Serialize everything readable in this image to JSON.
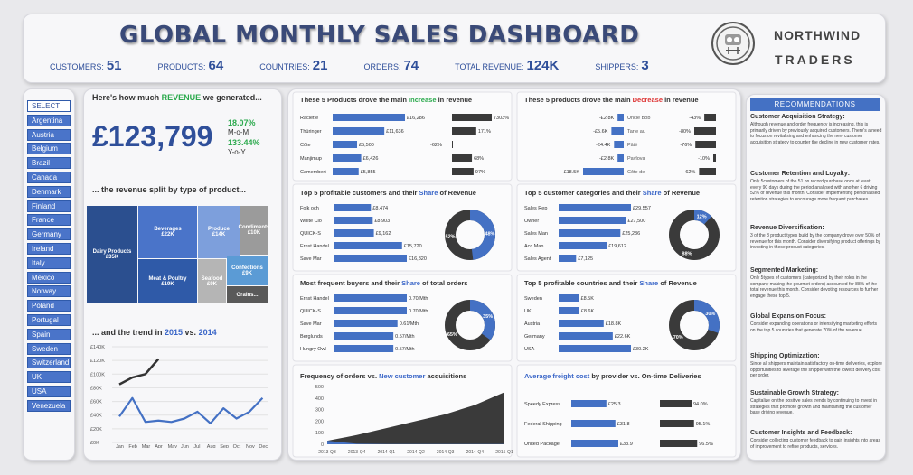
{
  "header": {
    "title": "GLOBAL MONTHLY SALES DASHBOARD",
    "brand_line1": "NORTHWIND",
    "brand_line2": "TRADERS",
    "kpis": [
      {
        "label": "CUSTOMERS:",
        "value": "51"
      },
      {
        "label": "PRODUCTS:",
        "value": "64"
      },
      {
        "label": "COUNTRIES:",
        "value": "21"
      },
      {
        "label": "ORDERS:",
        "value": "74"
      },
      {
        "label": "TOTAL REVENUE:",
        "value": "124K"
      },
      {
        "label": "SHIPPERS:",
        "value": "3"
      }
    ]
  },
  "countries": [
    "SELECT",
    "Argentina",
    "Austria",
    "Belgium",
    "Brazil",
    "Canada",
    "Denmark",
    "Finland",
    "France",
    "Germany",
    "Ireland",
    "Italy",
    "Mexico",
    "Norway",
    "Poland",
    "Portugal",
    "Spain",
    "Sweden",
    "Switzerland",
    "UK",
    "USA",
    "Venezuela"
  ],
  "revenue": {
    "title_pre": "Here's how much ",
    "title_hl": "REVENUE",
    "title_post": " we generated...",
    "value": "£123,799",
    "mom_pct": "18.07%",
    "mom_label": "M-o-M",
    "yoy_pct": "133.44%",
    "yoy_label": "Y-o-Y"
  },
  "split": {
    "title": "... the revenue split by type of product...",
    "tiles": [
      {
        "name": "Dairy Products",
        "value": "£35K"
      },
      {
        "name": "Beverages",
        "value": "£22K"
      },
      {
        "name": "Meat & Poultry",
        "value": "£19K"
      },
      {
        "name": "Produce",
        "value": "£14K"
      },
      {
        "name": "Condiments",
        "value": "£10K"
      },
      {
        "name": "Confections",
        "value": "£9K"
      },
      {
        "name": "Seafood",
        "value": "£9K"
      },
      {
        "name": "Grains...",
        "value": ""
      }
    ]
  },
  "trend": {
    "title_pre": "... and the trend in ",
    "y1": "2015",
    "title_mid": " vs. ",
    "y2": "2014",
    "yticks": [
      "£140K",
      "£120K",
      "£100K",
      "£80K",
      "£60K",
      "£40K",
      "£20K",
      "£0K"
    ],
    "months": [
      "Jan",
      "Feb",
      "Mar",
      "Apr",
      "May",
      "Jun",
      "Jul",
      "Aug",
      "Sep",
      "Oct",
      "Nov",
      "Dec"
    ]
  },
  "chart_data": [
    {
      "type": "bar",
      "title": "These 5 Products drove the main Increase in revenue",
      "categories": [
        "Raclette",
        "Thüringer",
        "Côte",
        "Manjimup",
        "Camembert"
      ],
      "values": [
        16286,
        11636,
        5500,
        6426,
        5855
      ],
      "labels": [
        "£16,286",
        "£11,636",
        "£5,500",
        "£6,426",
        "£5,855"
      ],
      "pct": [
        "7303%",
        "171%",
        "-62%",
        "68%",
        "97%"
      ]
    },
    {
      "type": "bar",
      "title": "These 5 products drove the main Decrease in revenue",
      "categories": [
        "Uncle Bob",
        "Tarte au",
        "Pâté",
        "Pavlova",
        "Côte de"
      ],
      "values": [
        -2800,
        -5600,
        -4400,
        -2800,
        -18500
      ],
      "labels": [
        "-£2.8K",
        "-£5.6K",
        "-£4.4K",
        "-£2.8K",
        "-£18.5K"
      ],
      "pct": [
        "-43%",
        "-80%",
        "-76%",
        "-10%",
        "-62%"
      ]
    },
    {
      "type": "bar",
      "title": "Top 5 profitable customers and their Share of Revenue",
      "categories": [
        "Folk och",
        "White Clo",
        "QUICK-S",
        "Ernst Handel",
        "Save Mar"
      ],
      "values": [
        8474,
        8903,
        9162,
        15720,
        16820
      ],
      "labels": [
        "£8,474",
        "£8,903",
        "£9,162",
        "£15,720",
        "£16,820"
      ],
      "donut": {
        "share": 48,
        "rest": 52
      }
    },
    {
      "type": "bar",
      "title": "Top 5 customer categories and their Share of Revenue",
      "categories": [
        "Sales Rep",
        "Owner",
        "Sales Man",
        "Acc Man",
        "Sales Agent"
      ],
      "values": [
        29557,
        27500,
        25236,
        19612,
        7125
      ],
      "labels": [
        "£29,557",
        "£27,500",
        "£25,236",
        "£19,612",
        "£7,125"
      ],
      "donut": {
        "share": 12,
        "rest": 88
      }
    },
    {
      "type": "bar",
      "title": "Most frequent buyers and their Share of total orders",
      "categories": [
        "Ernst Handel",
        "QUICK-S",
        "Save Mar",
        "Berglunds",
        "Hungry Owl"
      ],
      "values": [
        0.7,
        0.7,
        0.61,
        0.57,
        0.57
      ],
      "labels": [
        "0.70/Mth",
        "0.70/Mth",
        "0.61/Mth",
        "0.57/Mth",
        "0.57/Mth"
      ],
      "donut": {
        "share": 35,
        "rest": 65
      }
    },
    {
      "type": "bar",
      "title": "Top 5 profitable countries and their Share of Revenue",
      "categories": [
        "Sweden",
        "UK",
        "Austria",
        "Germany",
        "USA"
      ],
      "values": [
        8500,
        8600,
        18800,
        22600,
        30200
      ],
      "labels": [
        "£8.5K",
        "£8.6K",
        "£18.8K",
        "£22.6K",
        "£30.2K"
      ],
      "donut": {
        "share": 30,
        "rest": 70
      }
    },
    {
      "type": "area",
      "title": "Frequency of orders vs. New customer acquisitions",
      "x": [
        "2013-Q3",
        "2013-Q4",
        "2014-Q1",
        "2014-Q2",
        "2014-Q3",
        "2014-Q4",
        "2015-Q1"
      ],
      "series": [
        {
          "values": [
            30,
            80,
            140,
            200,
            260,
            340,
            450
          ]
        },
        {
          "values": [
            30,
            5,
            2,
            2,
            2,
            2,
            2
          ]
        }
      ],
      "ylim": [
        0,
        500
      ],
      "yticks": [
        "500",
        "400",
        "300",
        "200",
        "100",
        "0"
      ]
    },
    {
      "type": "bar",
      "title": "Average freight cost by provider vs. On-time Deliveries",
      "categories": [
        "Speedy Express",
        "Federal Shipping",
        "United Package"
      ],
      "values": [
        25.3,
        31.8,
        33.9
      ],
      "labels": [
        "£25.3",
        "£31.8",
        "£33.9"
      ],
      "pct": [
        "94.0%",
        "95.1%",
        "96.5%"
      ]
    },
    {
      "type": "line",
      "title": "... and the trend in 2015 vs. 2014",
      "x": [
        "Jan",
        "Feb",
        "Mar",
        "Apr",
        "May",
        "Jun",
        "Jul",
        "Aug",
        "Sep",
        "Oct",
        "Nov",
        "Dec"
      ],
      "series": [
        {
          "name": "2015",
          "values": [
            85,
            95,
            100,
            122,
            null,
            null,
            null,
            null,
            null,
            null,
            null,
            null
          ]
        },
        {
          "name": "2014",
          "values": [
            38,
            65,
            30,
            32,
            30,
            35,
            45,
            28,
            50,
            35,
            45,
            65
          ]
        }
      ],
      "ylim": [
        0,
        140
      ]
    }
  ],
  "recs": {
    "title": "RECOMMENDATIONS",
    "items": [
      {
        "h": "Customer Acquisition Strategy:",
        "b": "Although revenue and order frequency is increasing, this is primarily driven by previously acquired customers. There's a need to focus on revitalising and enhancing the new customer acquisition strategy to counter the decline in new customer rates."
      },
      {
        "h": "Customer Retention and Loyalty:",
        "b": "Only 5customers of the 51 on record purchase once at least every 90 days during the period analysed with another 6 driving 52% of revenue this month. Consider implementing personalised retention strategies to encourage more frequent purchases."
      },
      {
        "h": "Revenue Diversification:",
        "b": "3 of the 8 product types build by the company drove over 50% of revenue for this month. Consider diversifying product offerings by investing in these product categories."
      },
      {
        "h": "Segmented Marketing:",
        "b": "Only 5types of customers (categorized by their roles in the company making the gourmet orders) accounted for 88% of the total revenue this month. Consider devoting resources to further engage these top 5."
      },
      {
        "h": "Global Expansion Focus:",
        "b": "Consider expanding operations or intensifying marketing efforts on the top 5 countries that generate 70% of the revenue."
      },
      {
        "h": "Shipping Optimization:",
        "b": "Since all shippers maintain satisfactory on-time deliveries, explore opportunities to leverage the shipper with the lowest delivery cost per order."
      },
      {
        "h": "Sustainable Growth Strategy:",
        "b": "Capitalize on the positive sales trends by continuing to invest in strategies that promote growth and maintaining the customer base driving revenue."
      },
      {
        "h": "Customer Insights and Feedback:",
        "b": "Consider collecting customer feedback to gain insights into areas of improvement to refine products, services."
      }
    ]
  }
}
